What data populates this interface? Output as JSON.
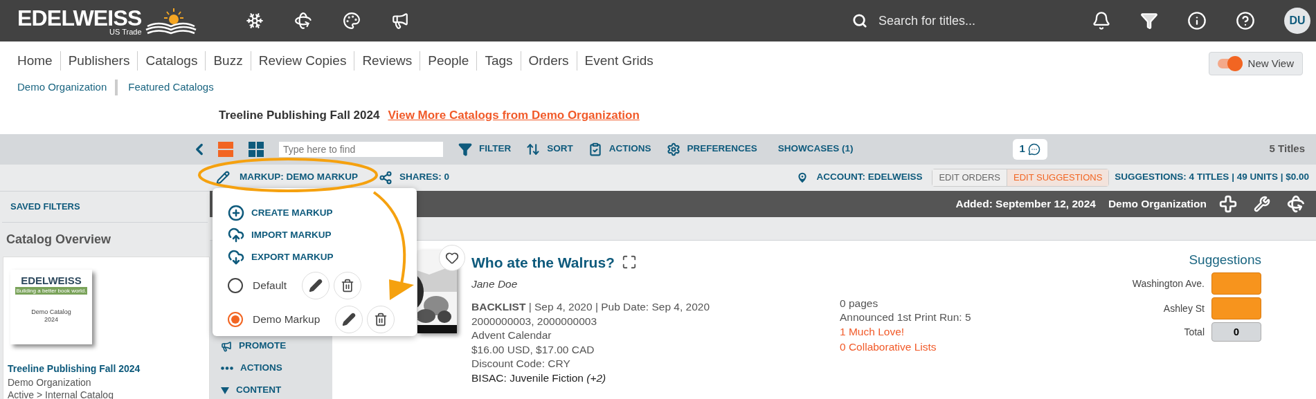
{
  "header": {
    "logo": "EDELWEISS",
    "logo_sub": "US Trade",
    "search": {
      "placeholder": "Search for titles..."
    },
    "avatar": "DU"
  },
  "nav": {
    "items": [
      "Home",
      "Publishers",
      "Catalogs",
      "Buzz",
      "Review Copies",
      "Reviews",
      "People",
      "Tags",
      "Orders",
      "Event Grids"
    ]
  },
  "breadcrumbs": [
    "Demo Organization",
    "Featured Catalogs"
  ],
  "new_view": {
    "label": "New View",
    "on": true
  },
  "catalog_heading": {
    "title": "Treeline Publishing Fall 2024",
    "link": "View More Catalogs from Demo Organization"
  },
  "toolbar": {
    "layouts": [
      {
        "kind": "list",
        "selected": true
      },
      {
        "kind": "grid",
        "selected": false
      }
    ],
    "find": {
      "placeholder": "Type here to find"
    },
    "actions": [
      {
        "kind": "filter",
        "label": "FILTER"
      },
      {
        "kind": "sort",
        "label": "SORT"
      },
      {
        "kind": "actions",
        "label": "ACTIONS"
      },
      {
        "kind": "preferences",
        "label": "PREFERENCES"
      },
      {
        "kind": "showcases",
        "label": "SHOWCASES (1)"
      }
    ],
    "comments": "1",
    "count": "5 Titles"
  },
  "subtoolbar": {
    "markup": "MARKUP: DEMO MARKUP",
    "shares": "SHARES: 0",
    "account": "ACCOUNT: EDELWEISS",
    "modes": [
      {
        "label": "EDIT ORDERS",
        "selected": false
      },
      {
        "label": "EDIT SUGGESTIONS",
        "selected": true
      }
    ],
    "summary": "SUGGESTIONS: 4 TITLES | 49 UNITS | $0.00"
  },
  "markup_menu": {
    "commands": [
      {
        "kind": "create",
        "label": "CREATE MARKUP"
      },
      {
        "kind": "import",
        "label": "IMPORT MARKUP"
      },
      {
        "kind": "export",
        "label": "EXPORT MARKUP"
      }
    ],
    "markups": [
      {
        "name": "Default",
        "selected": false
      },
      {
        "name": "Demo Markup",
        "selected": true
      }
    ]
  },
  "sidebar": {
    "saved_filters": "SAVED FILTERS",
    "overview_title": "Catalog Overview",
    "cover": {
      "brand": "EDELWEISS",
      "tagline": "Building a better book world.",
      "title": "Demo Catalog",
      "year": "2024"
    },
    "catalog_name": "Treeline Publishing Fall 2024",
    "organization": "Demo Organization",
    "status": "Active > Internal Catalog"
  },
  "side_menu": [
    {
      "kind": "promote",
      "label": "PROMOTE"
    },
    {
      "kind": "actions",
      "label": "ACTIONS"
    },
    {
      "kind": "content",
      "label": "CONTENT"
    }
  ],
  "title_bar": {
    "added": "Added: September 12, 2024",
    "organization": "Demo Organization"
  },
  "book": {
    "title": "Who ate the Walrus?",
    "author": "Jane Doe",
    "details": [
      "**BACKLIST** | Sep 4, 2020 | Pub Date: Sep 4, 2020",
      "2000000003, 2000000003",
      "Advent Calendar",
      "$16.00 USD, $17.00 CAD",
      "Discount Code: CRY",
      "BISAC: Juvenile Fiction *(+2)*"
    ],
    "stats": [
      {
        "kind": "plain",
        "text": "0 pages"
      },
      {
        "kind": "plain",
        "text": "Announced 1st Print Run: 5"
      },
      {
        "kind": "link",
        "text": "1 Much Love!"
      },
      {
        "kind": "link",
        "text": "0 Collaborative Lists"
      }
    ]
  },
  "suggestions": {
    "title": "Suggestions",
    "stores": [
      "Washington Ave.",
      "Ashley St"
    ],
    "total_label": "Total",
    "total": "0"
  }
}
